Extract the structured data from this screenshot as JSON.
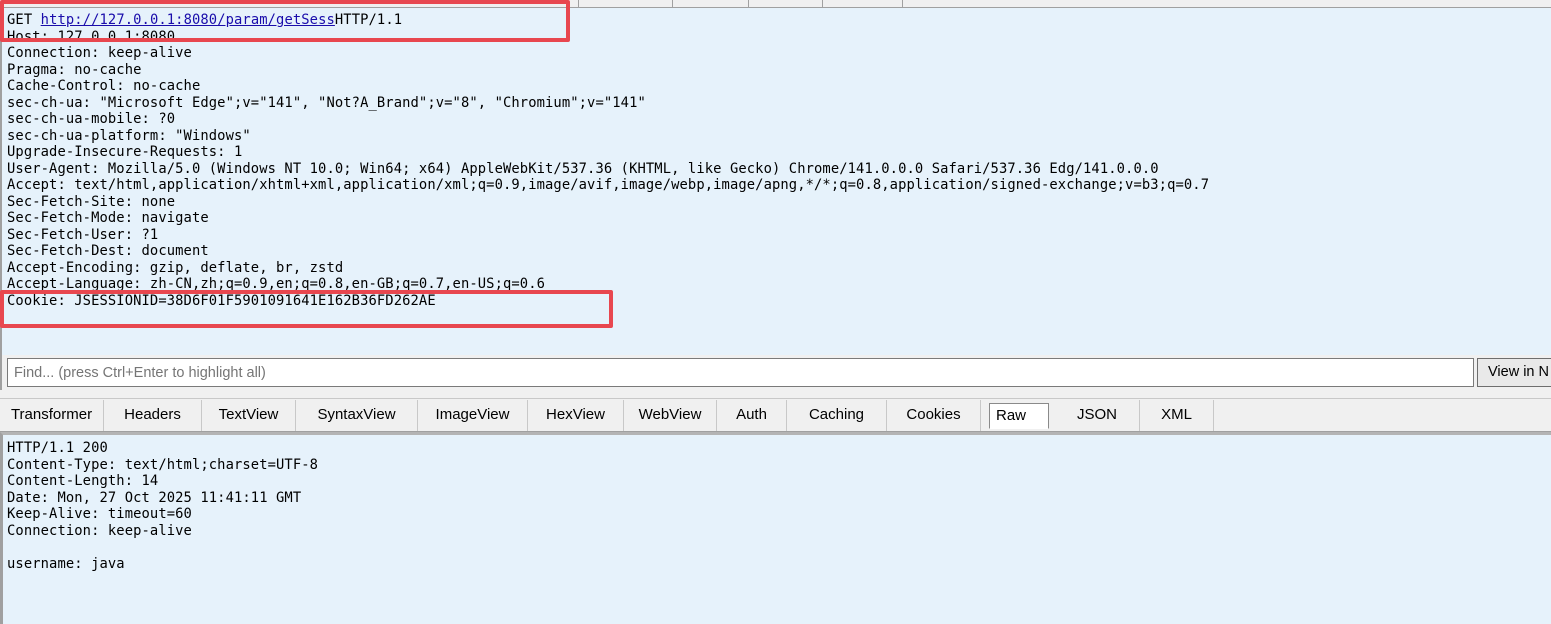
{
  "request": {
    "method": "GET",
    "url": "http://127.0.0.1:8080/param/getSess",
    "protocol": "HTTP/1.1",
    "headers": [
      "Host: 127.0.0.1:8080",
      "Connection: keep-alive",
      "Pragma: no-cache",
      "Cache-Control: no-cache",
      "sec-ch-ua: \"Microsoft Edge\";v=\"141\", \"Not?A_Brand\";v=\"8\", \"Chromium\";v=\"141\"",
      "sec-ch-ua-mobile: ?0",
      "sec-ch-ua-platform: \"Windows\"",
      "Upgrade-Insecure-Requests: 1",
      "User-Agent: Mozilla/5.0 (Windows NT 10.0; Win64; x64) AppleWebKit/537.36 (KHTML, like Gecko) Chrome/141.0.0.0 Safari/537.36 Edg/141.0.0.0",
      "Accept: text/html,application/xhtml+xml,application/xml;q=0.9,image/avif,image/webp,image/apng,*/*;q=0.8,application/signed-exchange;v=b3;q=0.7",
      "Sec-Fetch-Site: none",
      "Sec-Fetch-Mode: navigate",
      "Sec-Fetch-User: ?1",
      "Sec-Fetch-Dest: document",
      "Accept-Encoding: gzip, deflate, br, zstd",
      "Accept-Language: zh-CN,zh;q=0.9,en;q=0.8,en-GB;q=0.7,en-US;q=0.6",
      "Cookie: JSESSIONID=38D6F01F5901091641E162B36FD262AE"
    ]
  },
  "find": {
    "placeholder": "Find... (press Ctrl+Enter to highlight all)",
    "view_button": "View in N"
  },
  "response_tabs": [
    {
      "label": "Transformer",
      "active": false
    },
    {
      "label": "Headers",
      "active": false
    },
    {
      "label": "TextView",
      "active": false
    },
    {
      "label": "SyntaxView",
      "active": false
    },
    {
      "label": "ImageView",
      "active": false
    },
    {
      "label": "HexView",
      "active": false
    },
    {
      "label": "WebView",
      "active": false
    },
    {
      "label": "Auth",
      "active": false
    },
    {
      "label": "Caching",
      "active": false
    },
    {
      "label": "Cookies",
      "active": false
    },
    {
      "label": "Raw",
      "active": true
    },
    {
      "label": "JSON",
      "active": false
    },
    {
      "label": "XML",
      "active": false
    }
  ],
  "response": {
    "lines": [
      "HTTP/1.1 200",
      "Content-Type: text/html;charset=UTF-8",
      "Content-Length: 14",
      "Date: Mon, 27 Oct 2025 11:41:11 GMT",
      "Keep-Alive: timeout=60",
      "Connection: keep-alive",
      "",
      "username: java"
    ]
  },
  "colors": {
    "pane_background": "#e6f2fb",
    "highlight_box": "#e8474f",
    "url_link": "#1a0dab"
  }
}
